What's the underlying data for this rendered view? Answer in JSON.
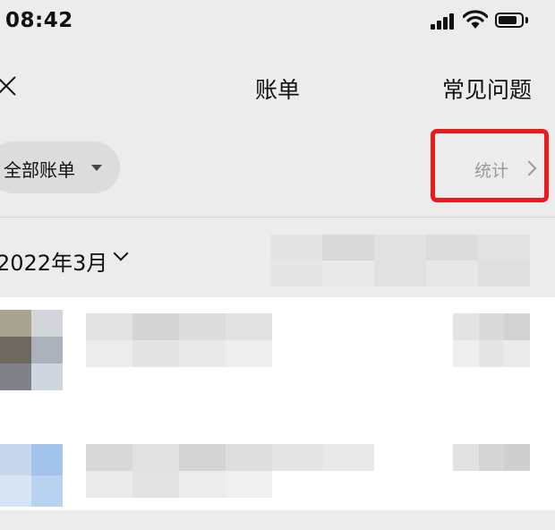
{
  "status_bar": {
    "time": "08:42",
    "icons": [
      "cellular-signal-icon",
      "wifi-icon",
      "battery-icon"
    ]
  },
  "header": {
    "close_icon": "close-icon",
    "title": "账单",
    "faq_label": "常见问题"
  },
  "filter": {
    "label": "全部账单",
    "caret_icon": "caret-down-icon"
  },
  "stats": {
    "label": "统计",
    "chevron_icon": "chevron-right-icon",
    "highlight_color": "#ec1b1b"
  },
  "month": {
    "label": "2022年3月",
    "chevron_icon": "chevron-down-icon",
    "summary": "pixelated"
  },
  "transactions": [
    {
      "content": "pixelated"
    },
    {
      "content": "pixelated"
    }
  ],
  "colors": {
    "background": "#ececec",
    "list_background": "#ffffff",
    "text": "#111111",
    "muted_text": "#9a9a9a",
    "pill": "#dcdcdc"
  }
}
